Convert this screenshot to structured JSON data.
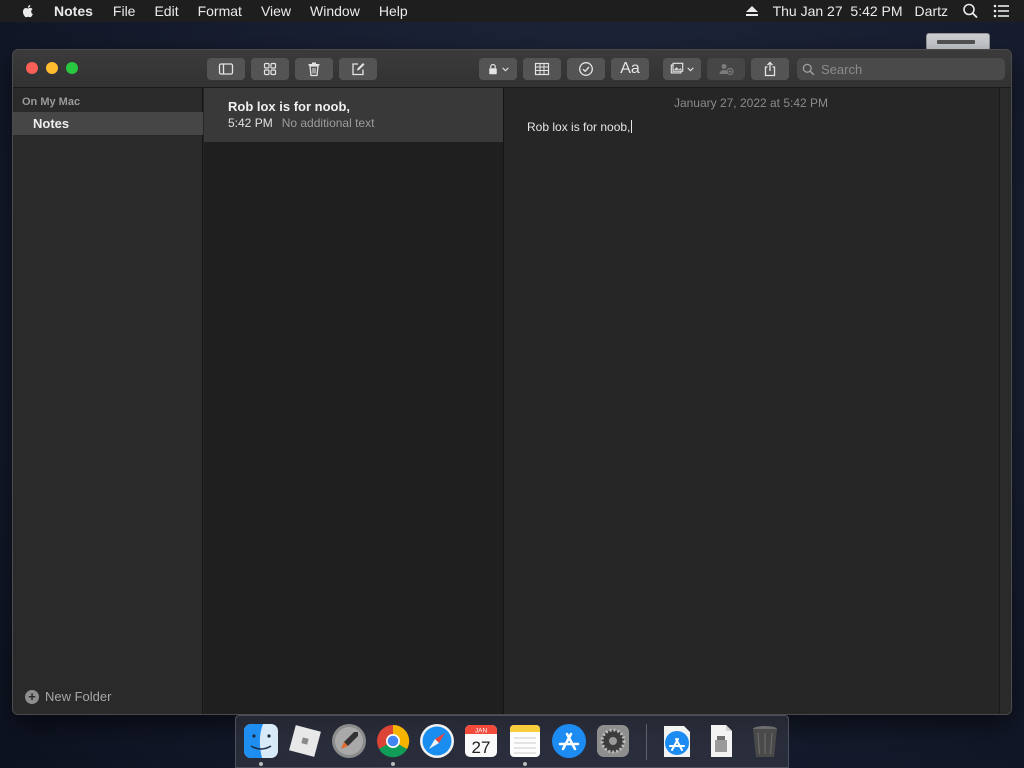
{
  "menubar": {
    "app_name": "Notes",
    "menus": [
      "File",
      "Edit",
      "Format",
      "View",
      "Window",
      "Help"
    ],
    "clock": "Thu Jan 27  5:42 PM",
    "user": "Dartz"
  },
  "toolbar": {
    "search_placeholder": "Search",
    "format_label": "Aa"
  },
  "sidebar": {
    "section": "On My Mac",
    "folders": [
      {
        "label": "Notes",
        "selected": true
      }
    ],
    "new_folder_label": "New Folder"
  },
  "notes": [
    {
      "title": "Rob lox is for noob,",
      "time": "5:42 PM",
      "preview": "No additional text"
    }
  ],
  "editor": {
    "date": "January 27, 2022 at 5:42 PM",
    "body": "Rob lox is for noob,"
  },
  "dock": {
    "apps": [
      "finder-icon",
      "roblox-icon",
      "launchpad-icon",
      "chrome-icon",
      "safari-icon",
      "calendar-icon",
      "notes-icon",
      "app-store-icon",
      "system-preferences-icon",
      "app-store-downloads-icon",
      "document-icon",
      "trash-icon"
    ],
    "calendar": {
      "month": "JAN",
      "day": "27"
    }
  },
  "colors": {
    "close": "#fe5f57",
    "minimize": "#febc2e",
    "zoom": "#28c840",
    "selection": "#464646"
  }
}
